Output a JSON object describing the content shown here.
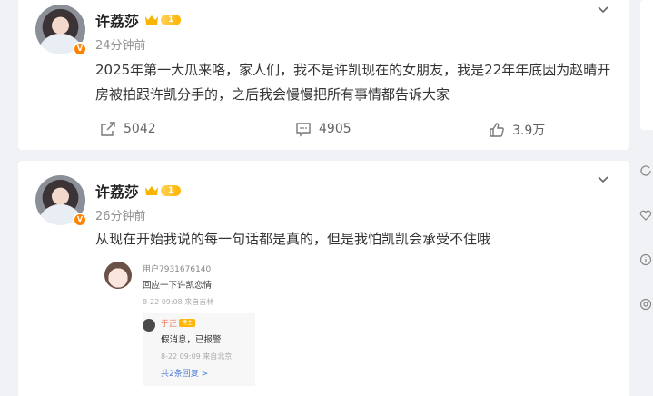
{
  "posts": [
    {
      "author": "许荔莎",
      "level": "1",
      "time": "24分钟前",
      "text": "2025年第一大瓜来咯，家人们，我不是许凯现在的女朋友，我是22年年底因为赵晴开房被拍跟许凯分手的，之后我会慢慢把所有事情都告诉大家",
      "reposts": "5042",
      "comments": "4905",
      "likes": "3.9万"
    },
    {
      "author": "许荔莎",
      "level": "1",
      "time": "26分钟前",
      "text": "从现在开始我说的每一句话都是真的，但是我怕凯凯会承受不住哦",
      "embedded_comment": {
        "user": "用户7931676140",
        "message": "回应一下许凯恋情",
        "meta": "8-22 09:08 来自吉林",
        "reply_user": "于正",
        "reply_tag": "博主",
        "reply_message": "假消息，已报警",
        "reply_meta": "8-22 09:09 来自北京",
        "more_replies": "共2条回复 >"
      }
    }
  ],
  "colors": {
    "background": "#f1f2f5",
    "card": "#ffffff",
    "accent": "#ff8200",
    "link": "#4c7ad6"
  },
  "icons": [
    "chevron-down-icon",
    "repost-icon",
    "comment-icon",
    "like-icon",
    "verified-icon",
    "crown-icon"
  ]
}
